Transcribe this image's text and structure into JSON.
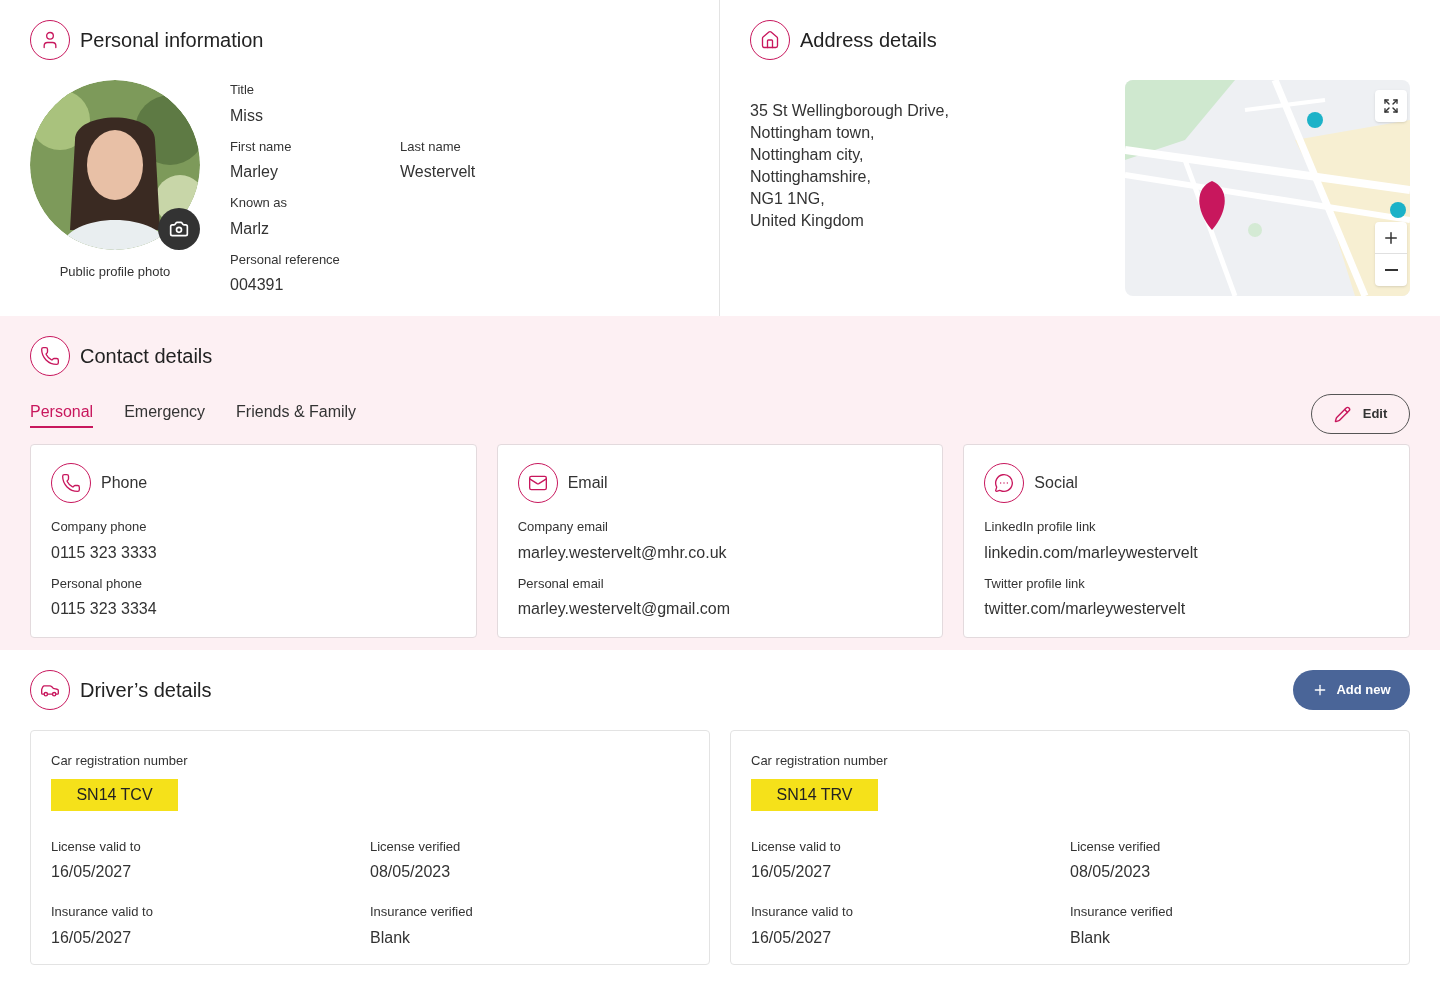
{
  "personal": {
    "title": "Personal information",
    "photo_label": "Public profile photo",
    "rows": [
      [
        {
          "label": "Title",
          "value": "Miss"
        }
      ],
      [
        {
          "label": "First name",
          "value": "Marley"
        },
        {
          "label": "Last name",
          "value": "Westervelt"
        }
      ],
      [
        {
          "label": "Known as",
          "value": "Marlz"
        }
      ],
      [
        {
          "label": "Personal reference",
          "value": "004391"
        }
      ]
    ]
  },
  "address": {
    "title": "Address details",
    "lines": [
      "35 St Wellingborough Drive,",
      "Nottingham town,",
      "Nottingham city,",
      "Nottinghamshire,",
      "NG1 1NG,",
      "United Kingdom"
    ]
  },
  "contact": {
    "title": "Contact details",
    "tabs": [
      {
        "label": "Personal",
        "selected": true
      },
      {
        "label": "Emergency",
        "selected": false
      },
      {
        "label": "Friends & Family",
        "selected": false
      }
    ],
    "edit_button": "Edit",
    "cards": [
      {
        "kind": "phone",
        "title": "Phone",
        "fields": [
          {
            "label": "Company phone",
            "value": "0115 323 3333"
          },
          {
            "label": "Personal phone",
            "value": "0115 323 3334"
          }
        ]
      },
      {
        "kind": "email",
        "title": "Email",
        "fields": [
          {
            "label": "Company email",
            "value": "marley.westervelt@mhr.co.uk"
          },
          {
            "label": "Personal email",
            "value": "marley.westervelt@gmail.com"
          }
        ]
      },
      {
        "kind": "social",
        "title": "Social",
        "fields": [
          {
            "label": "LinkedIn profile link",
            "value": "linkedin.com/marleywestervelt"
          },
          {
            "label": "Twitter profile link",
            "value": "twitter.com/marleywestervelt"
          }
        ]
      }
    ]
  },
  "drivers": {
    "title": "Driver’s details",
    "add_button": "Add new",
    "cards": [
      {
        "reg_label": "Car registration number",
        "reg": "SN14 TCV",
        "fields": [
          {
            "label": "License valid to",
            "value": "16/05/2027"
          },
          {
            "label": "License verified",
            "value": "08/05/2023"
          },
          {
            "label": "Insurance valid to",
            "value": "16/05/2027"
          },
          {
            "label": "Insurance verified",
            "value": "Blank"
          }
        ]
      },
      {
        "reg_label": "Car registration number",
        "reg": "SN14 TRV",
        "fields": [
          {
            "label": "License valid to",
            "value": "16/05/2027"
          },
          {
            "label": "License verified",
            "value": "08/05/2023"
          },
          {
            "label": "Insurance valid to",
            "value": "16/05/2027"
          },
          {
            "label": "Insurance verified",
            "value": "Blank"
          }
        ]
      }
    ]
  }
}
